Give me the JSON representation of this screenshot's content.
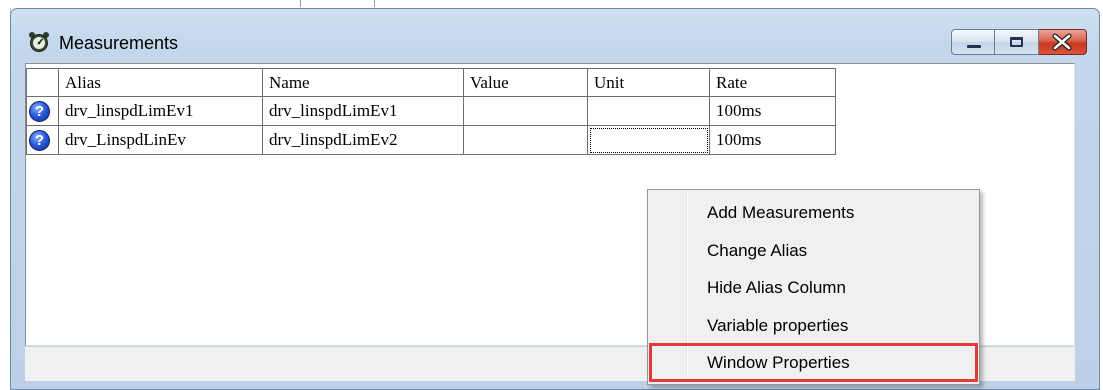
{
  "window": {
    "title": "Measurements",
    "icon": "measurement-gauge-icon",
    "controls": [
      "minimize-icon",
      "maximize-icon",
      "close-icon"
    ]
  },
  "grid": {
    "columns": [
      "Alias",
      "Name",
      "Value",
      "Unit",
      "Rate"
    ],
    "rows": [
      {
        "status_icon": "help-icon",
        "alias": "drv_linspdLimEv1",
        "name": "drv_linspdLimEv1",
        "value": "",
        "unit": "",
        "rate": "100ms"
      },
      {
        "status_icon": "help-icon",
        "alias": "drv_LinspdLinEv",
        "name": "drv_linspdLimEv2",
        "value": "",
        "unit": "",
        "rate": "100ms"
      }
    ]
  },
  "context_menu": {
    "items": [
      {
        "label": "Add Measurements"
      },
      {
        "label": "Change Alias"
      },
      {
        "label": "Hide Alias Column"
      },
      {
        "label": "Variable properties"
      },
      {
        "label": "Window Properties"
      }
    ],
    "highlighted_item": "Window Properties",
    "highlight_color": "#e03a3a"
  }
}
